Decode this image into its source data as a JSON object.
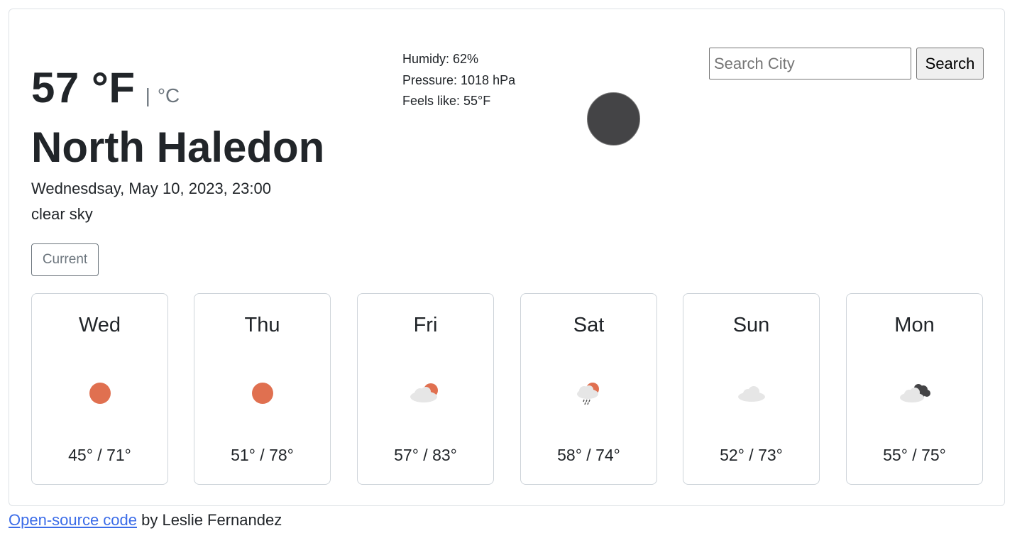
{
  "current": {
    "temperature": "57 °F",
    "unit_separator": "|",
    "unit_alt": "°C",
    "city": "North Haledon",
    "date": "Wednesdsay, May 10, 2023, 23:00",
    "description": "clear sky",
    "icon": "moon-icon",
    "current_button": "Current"
  },
  "stats": {
    "humidity": "Humidy: 62%",
    "pressure": "Pressure: 1018 hPa",
    "feels_like": "Feels like: 55°F"
  },
  "search": {
    "placeholder": "Search City",
    "button_label": "Search"
  },
  "forecast": [
    {
      "day": "Wed",
      "temps": "45° / 71°",
      "icon": "sun-icon"
    },
    {
      "day": "Thu",
      "temps": "51° / 78°",
      "icon": "sun-icon"
    },
    {
      "day": "Fri",
      "temps": "57° / 83°",
      "icon": "partly-cloudy-icon"
    },
    {
      "day": "Sat",
      "temps": "58° / 74°",
      "icon": "rain-sun-cloud-icon"
    },
    {
      "day": "Sun",
      "temps": "52° / 73°",
      "icon": "cloud-icon"
    },
    {
      "day": "Mon",
      "temps": "55° / 75°",
      "icon": "broken-clouds-icon"
    }
  ],
  "footer": {
    "link_text": "Open-source code",
    "author_text": " by Leslie Fernandez"
  },
  "colors": {
    "sun": "#e07050",
    "cloud": "#e6e6e6",
    "dark_cloud": "#444446",
    "link": "#3b6ce8"
  }
}
